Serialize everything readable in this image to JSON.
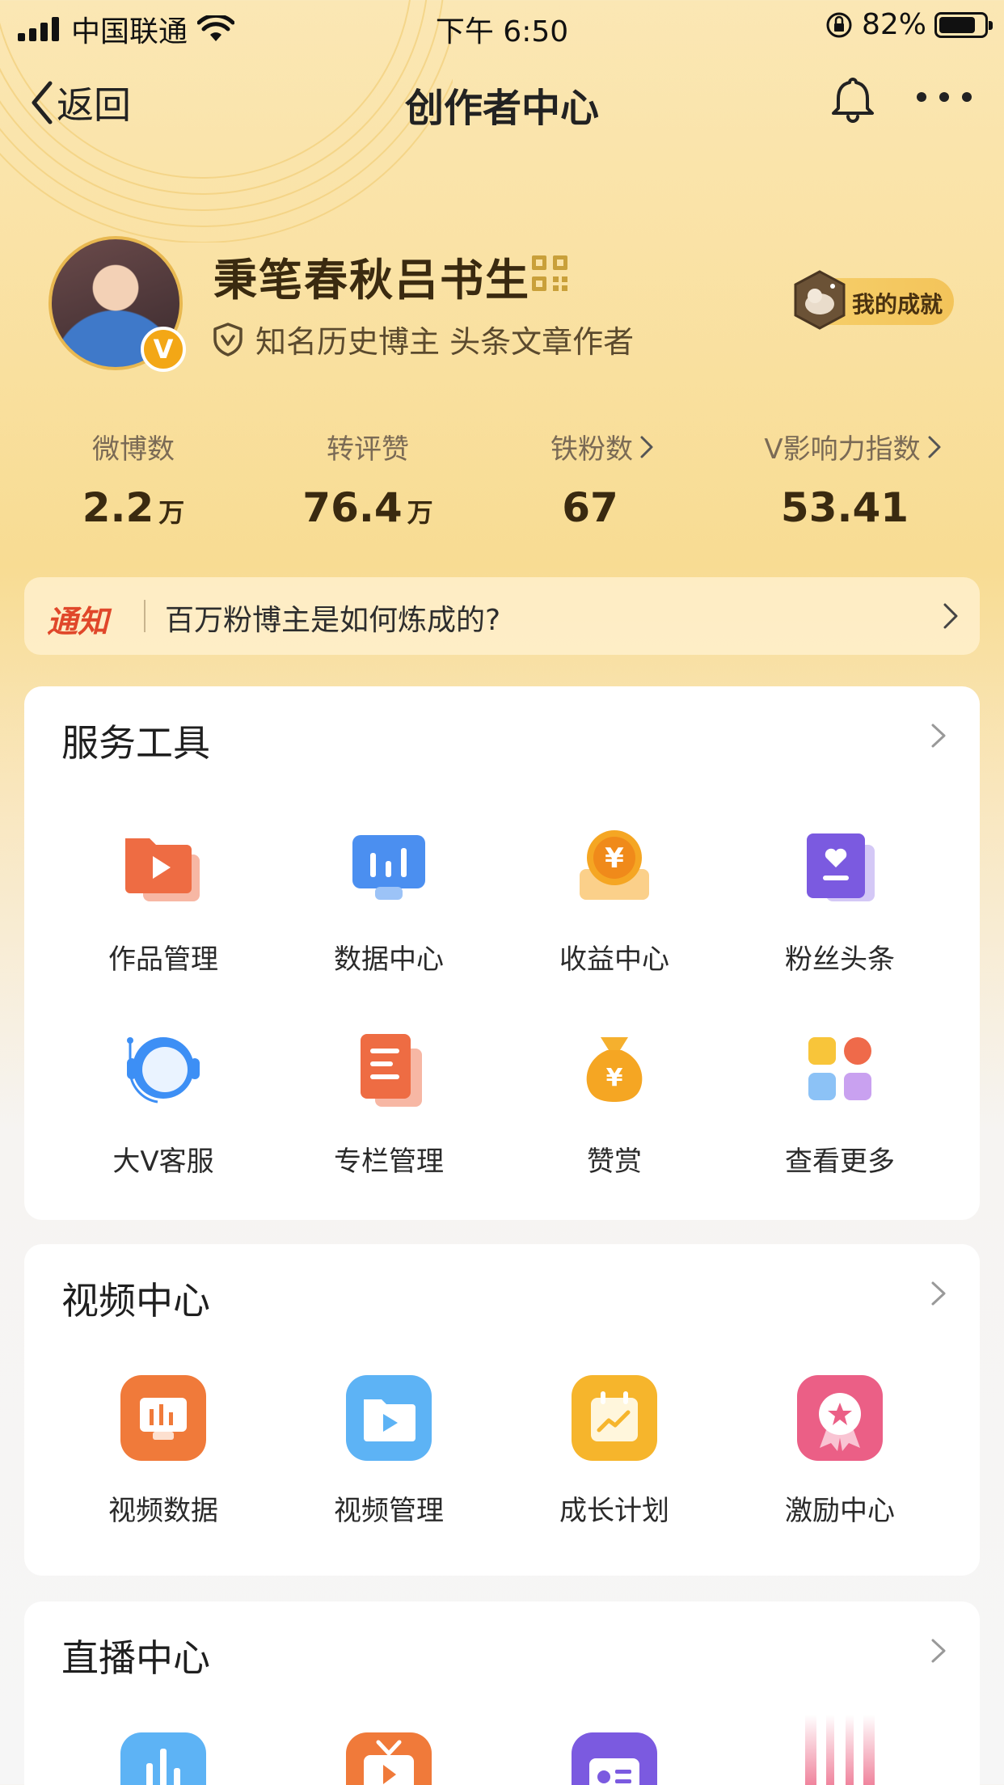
{
  "status_bar": {
    "carrier": "中国联通",
    "time": "下午 6:50",
    "battery_percent": "82%",
    "battery_level": 0.82
  },
  "nav": {
    "back_label": "返回",
    "title": "创作者中心"
  },
  "profile": {
    "name": "秉笔春秋吕书生",
    "verify_badge": "V",
    "verification": "知名历史博主 头条文章作者",
    "achievement_label": "我的成就"
  },
  "stats": [
    {
      "label": "微博数",
      "value": "2.2",
      "unit": "万"
    },
    {
      "label": "转评赞",
      "value": "76.4",
      "unit": "万"
    },
    {
      "label": "铁粉数",
      "value": "67",
      "unit": ""
    },
    {
      "label": "V影响力指数",
      "value": "53.41",
      "unit": ""
    }
  ],
  "notice": {
    "tag": "通知",
    "text": "百万粉博主是如何炼成的?"
  },
  "service_tools": {
    "title": "服务工具",
    "items": [
      {
        "label": "作品管理",
        "icon": "works-folder-icon"
      },
      {
        "label": "数据中心",
        "icon": "data-monitor-icon"
      },
      {
        "label": "收益中心",
        "icon": "income-coin-icon"
      },
      {
        "label": "粉丝头条",
        "icon": "fan-headline-icon"
      },
      {
        "label": "大V客服",
        "icon": "customer-service-icon"
      },
      {
        "label": "专栏管理",
        "icon": "column-doc-icon"
      },
      {
        "label": "赞赏",
        "icon": "reward-bag-icon"
      },
      {
        "label": "查看更多",
        "icon": "more-grid-icon"
      }
    ]
  },
  "video_center": {
    "title": "视频中心",
    "items": [
      {
        "label": "视频数据",
        "icon": "video-data-icon"
      },
      {
        "label": "视频管理",
        "icon": "video-manage-icon"
      },
      {
        "label": "成长计划",
        "icon": "growth-plan-icon"
      },
      {
        "label": "激励中心",
        "icon": "incentive-icon"
      }
    ]
  },
  "live_center": {
    "title": "直播中心"
  },
  "colors": {
    "accent_gold": "#f3a716",
    "notice_red": "#e0472a"
  }
}
